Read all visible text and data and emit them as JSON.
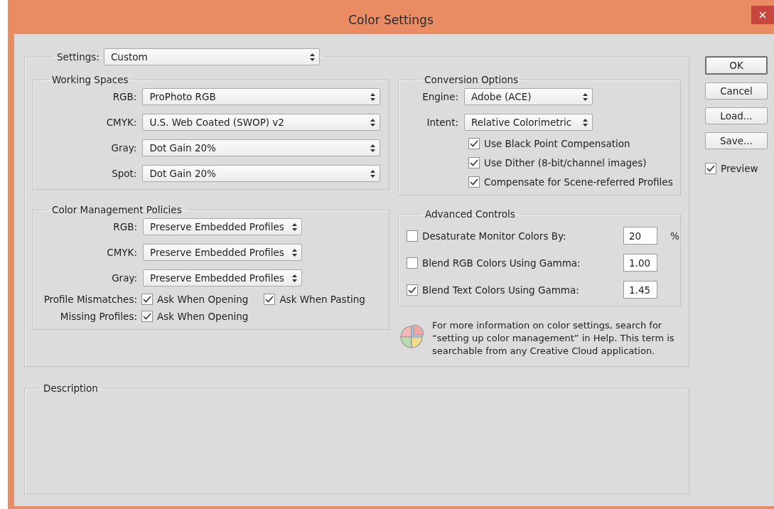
{
  "window": {
    "title": "Color Settings"
  },
  "settings": {
    "label": "Settings:",
    "value": "Custom"
  },
  "working_spaces": {
    "title": "Working Spaces",
    "rows": [
      {
        "label": "RGB:",
        "value": "ProPhoto RGB"
      },
      {
        "label": "CMYK:",
        "value": "U.S. Web Coated (SWOP) v2"
      },
      {
        "label": "Gray:",
        "value": "Dot Gain 20%"
      },
      {
        "label": "Spot:",
        "value": "Dot Gain 20%"
      }
    ]
  },
  "policies": {
    "title": "Color Management Policies",
    "rows": [
      {
        "label": "RGB:",
        "value": "Preserve Embedded Profiles"
      },
      {
        "label": "CMYK:",
        "value": "Preserve Embedded Profiles"
      },
      {
        "label": "Gray:",
        "value": "Preserve Embedded Profiles"
      }
    ],
    "checks": [
      {
        "label": "Profile Mismatches:",
        "options": [
          {
            "label": "Ask When Opening",
            "checked": true
          },
          {
            "label": "Ask When Pasting",
            "checked": true
          }
        ]
      },
      {
        "label": "Missing Profiles:",
        "options": [
          {
            "label": "Ask When Opening",
            "checked": true
          }
        ]
      }
    ]
  },
  "conversion": {
    "title": "Conversion Options",
    "selects": [
      {
        "label": "Engine:",
        "value": "Adobe (ACE)"
      },
      {
        "label": "Intent:",
        "value": "Relative Colorimetric"
      }
    ],
    "options": [
      {
        "label": "Use Black Point Compensation",
        "checked": true
      },
      {
        "label": "Use Dither (8-bit/channel images)",
        "checked": true
      },
      {
        "label": "Compensate for Scene-referred Profiles",
        "checked": true
      }
    ]
  },
  "advanced": {
    "title": "Advanced Controls",
    "rows": [
      {
        "label": "Desaturate Monitor Colors By:",
        "checked": false,
        "value": "20",
        "unit": "%"
      },
      {
        "label": "Blend RGB Colors Using Gamma:",
        "checked": false,
        "value": "1.00"
      },
      {
        "label": "Blend Text Colors Using Gamma:",
        "checked": true,
        "value": "1.45"
      }
    ]
  },
  "info": "For more information on color settings, search for “setting up color management” in Help. This term is searchable from any Creative Cloud application.",
  "buttons": [
    {
      "label": "OK",
      "default": true
    },
    {
      "label": "Cancel",
      "default": false
    },
    {
      "label": "Load...",
      "default": false
    },
    {
      "label": "Save...",
      "default": false
    }
  ],
  "preview": {
    "label": "Preview",
    "checked": true
  },
  "description": {
    "title": "Description"
  }
}
